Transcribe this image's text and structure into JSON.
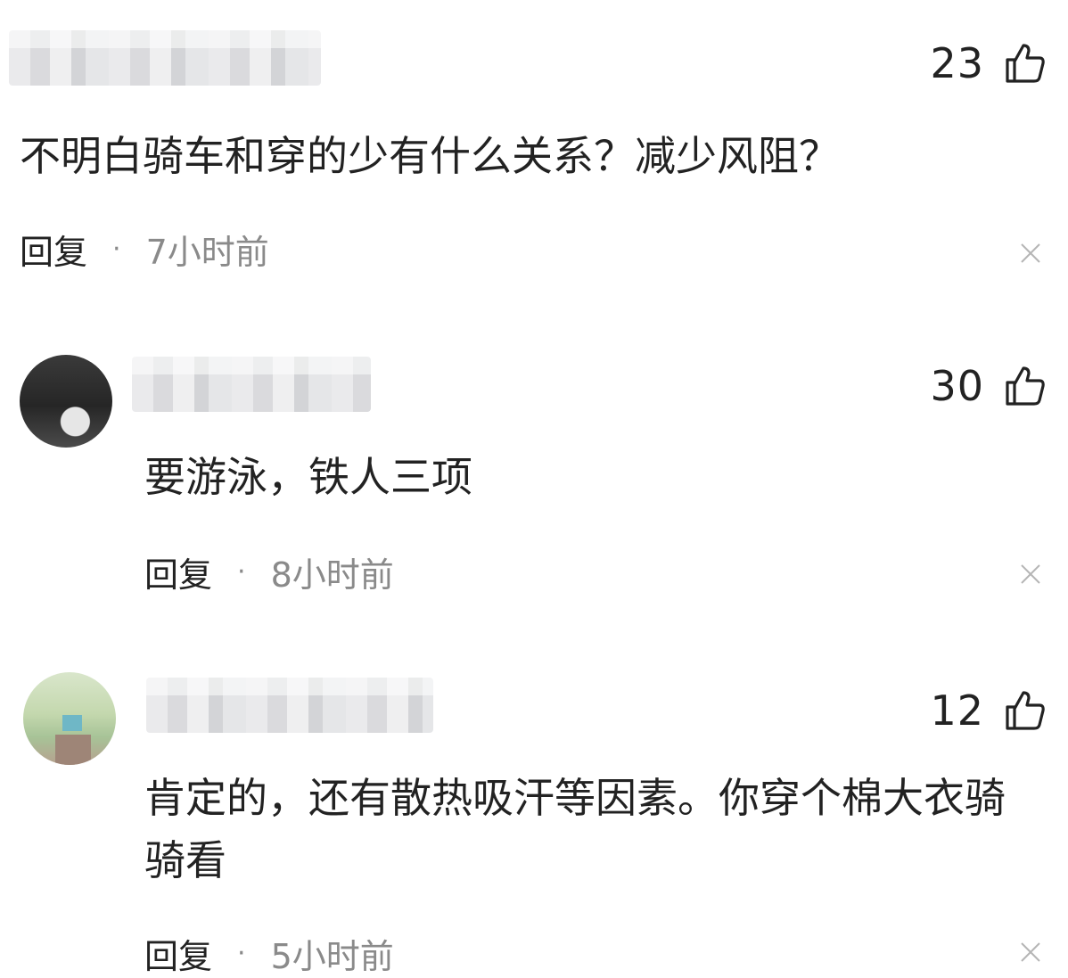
{
  "comments": [
    {
      "likes": "23",
      "text": "不明白骑车和穿的少有什么关系？减少风阻？",
      "reply_label": "回复",
      "separator": "·",
      "time": "7小时前",
      "avatar": "none"
    },
    {
      "likes": "30",
      "text": "要游泳，铁人三项",
      "reply_label": "回复",
      "separator": "·",
      "time": "8小时前",
      "avatar": "dark-car"
    },
    {
      "likes": "12",
      "text": "肯定的，还有散热吸汗等因素。你穿个棉大衣骑骑看",
      "reply_label": "回复",
      "separator": "·",
      "time": "5小时前",
      "avatar": "green"
    }
  ],
  "icons": {
    "like": "thumbs-up-outline-icon",
    "close": "close-icon"
  },
  "colors": {
    "text": "#222222",
    "muted": "#8a8a8a",
    "background": "#ffffff"
  }
}
